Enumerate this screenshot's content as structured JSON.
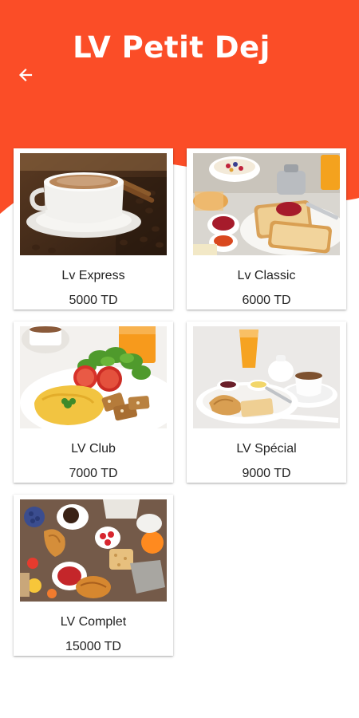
{
  "header": {
    "title": "LV Petit Dej",
    "back_icon": "arrow-left-icon",
    "color": "#fb4d27"
  },
  "menu": {
    "items": [
      {
        "name": "Lv Express",
        "price": "5000 TD",
        "image": "coffee-cup-photo"
      },
      {
        "name": "Lv Classic",
        "price": "6000 TD",
        "image": "toast-breakfast-photo"
      },
      {
        "name": "LV Club",
        "price": "7000 TD",
        "image": "omelette-plate-photo"
      },
      {
        "name": "LV Spécial",
        "price": "9000 TD",
        "image": "continental-tray-photo"
      },
      {
        "name": "LV Complet",
        "price": "15000 TD",
        "image": "breakfast-spread-photo"
      }
    ]
  }
}
